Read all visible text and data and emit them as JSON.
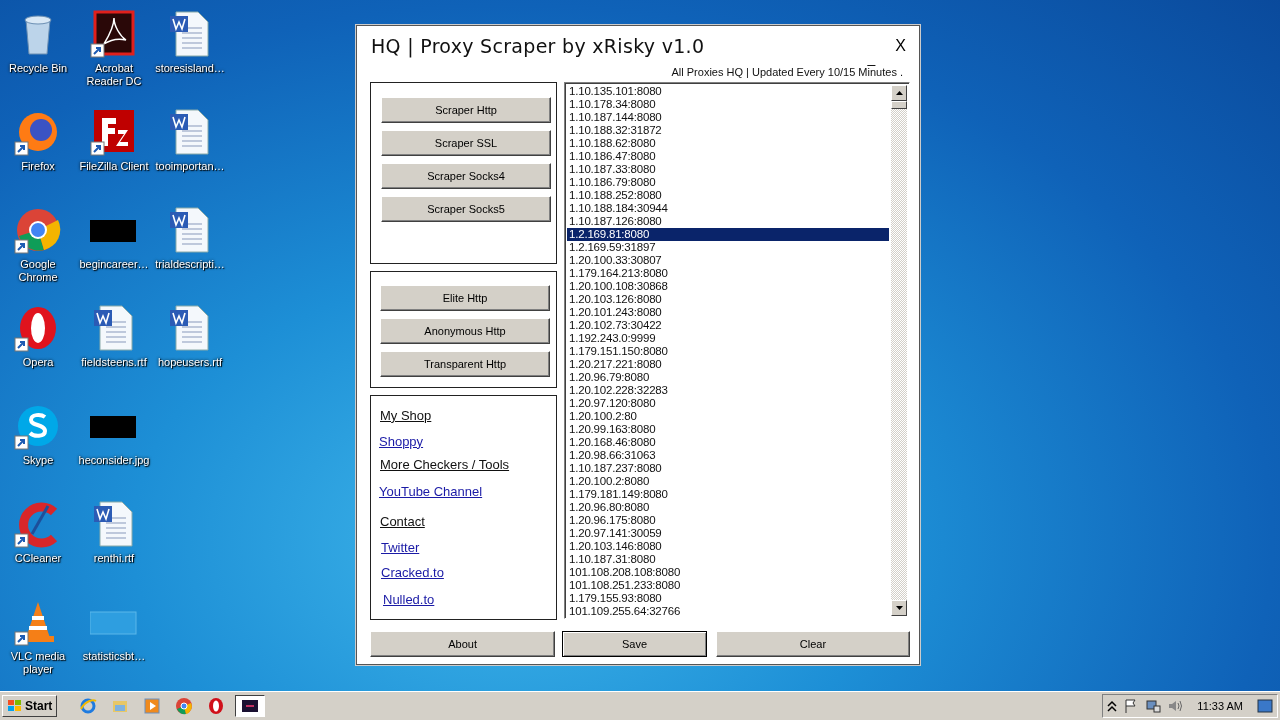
{
  "desktop": {
    "icons": [
      {
        "label": "Recycle Bin",
        "kind": "recycle",
        "shortcut": false
      },
      {
        "label": "Firefox",
        "kind": "firefox",
        "shortcut": true
      },
      {
        "label": "Google Chrome",
        "kind": "chrome",
        "shortcut": true
      },
      {
        "label": "Opera",
        "kind": "opera",
        "shortcut": true
      },
      {
        "label": "Skype",
        "kind": "skype",
        "shortcut": true
      },
      {
        "label": "CCleaner",
        "kind": "ccleaner",
        "shortcut": true
      },
      {
        "label": "VLC media player",
        "kind": "vlc",
        "shortcut": true
      },
      {
        "label": "Acrobat Reader DC",
        "kind": "pdf",
        "shortcut": true
      },
      {
        "label": "FileZilla Client",
        "kind": "filezilla",
        "shortcut": true
      },
      {
        "label": "begincareer…",
        "kind": "dark-image",
        "shortcut": false
      },
      {
        "label": "fieldsteens.rtf",
        "kind": "word",
        "shortcut": false
      },
      {
        "label": "heconsider.jpg",
        "kind": "dark-image",
        "shortcut": false
      },
      {
        "label": "renthi.rtf",
        "kind": "word",
        "shortcut": false
      },
      {
        "label": "statisticsbt…",
        "kind": "blank",
        "shortcut": false
      },
      {
        "label": "storesisland…",
        "kind": "word",
        "shortcut": false
      },
      {
        "label": "tooimportan…",
        "kind": "word",
        "shortcut": false
      },
      {
        "label": "trialdescripti…",
        "kind": "word",
        "shortcut": false
      },
      {
        "label": "hopeusers.rtf",
        "kind": "word",
        "shortcut": false
      }
    ]
  },
  "window": {
    "title": "HQ | Proxy Scraper by xRisky v1.0",
    "minimize": "_",
    "close": "X",
    "subtitle": "All Proxies HQ | Updated Every 10/15 Minutes ."
  },
  "scraper_buttons": [
    "Scraper Http",
    "Scraper SSL",
    "Scraper Socks4",
    "Scraper Socks5"
  ],
  "type_buttons": [
    "Elite Http",
    "Anonymous Http",
    "Transparent Http"
  ],
  "links": [
    {
      "text": "My Shop",
      "kind": "heading"
    },
    {
      "text": "Shoppy",
      "kind": "link"
    },
    {
      "text": "More Checkers / Tools",
      "kind": "heading"
    },
    {
      "text": "YouTube Channel",
      "kind": "link"
    },
    {
      "text": "Contact",
      "kind": "heading"
    },
    {
      "text": "Twitter",
      "kind": "link"
    },
    {
      "text": "Cracked.to",
      "kind": "link"
    },
    {
      "text": "Nulled.to",
      "kind": "link"
    }
  ],
  "proxies": [
    {
      "text": "1.10.135.101:8080",
      "selected": false
    },
    {
      "text": "1.10.178.34:8080",
      "selected": false
    },
    {
      "text": "1.10.187.144:8080",
      "selected": false
    },
    {
      "text": "1.10.188.32:31872",
      "selected": false
    },
    {
      "text": "1.10.188.62:8080",
      "selected": false
    },
    {
      "text": "1.10.186.47:8080",
      "selected": false
    },
    {
      "text": "1.10.187.33:8080",
      "selected": false
    },
    {
      "text": "1.10.186.79:8080",
      "selected": false
    },
    {
      "text": "1.10.188.252:8080",
      "selected": false
    },
    {
      "text": "1.10.188.184:30944",
      "selected": false
    },
    {
      "text": "1.10.187.126:8080",
      "selected": false
    },
    {
      "text": "1.2.169.81:8080",
      "selected": true
    },
    {
      "text": "1.2.169.59:31897",
      "selected": false
    },
    {
      "text": "1.20.100.33:30807",
      "selected": false
    },
    {
      "text": "1.179.164.213:8080",
      "selected": false
    },
    {
      "text": "1.20.100.108:30868",
      "selected": false
    },
    {
      "text": "1.20.103.126:8080",
      "selected": false
    },
    {
      "text": "1.20.101.243:8080",
      "selected": false
    },
    {
      "text": "1.20.102.73:30422",
      "selected": false
    },
    {
      "text": "1.192.243.0:9999",
      "selected": false
    },
    {
      "text": "1.179.151.150:8080",
      "selected": false
    },
    {
      "text": "1.20.217.221:8080",
      "selected": false
    },
    {
      "text": "1.20.96.79:8080",
      "selected": false
    },
    {
      "text": "1.20.102.228:32283",
      "selected": false
    },
    {
      "text": "1.20.97.120:8080",
      "selected": false
    },
    {
      "text": "1.20.100.2:80",
      "selected": false
    },
    {
      "text": "1.20.99.163:8080",
      "selected": false
    },
    {
      "text": "1.20.168.46:8080",
      "selected": false
    },
    {
      "text": "1.20.98.66:31063",
      "selected": false
    },
    {
      "text": "1.10.187.237:8080",
      "selected": false
    },
    {
      "text": "1.20.100.2:8080",
      "selected": false
    },
    {
      "text": "1.179.181.149:8080",
      "selected": false
    },
    {
      "text": "1.20.96.80:8080",
      "selected": false
    },
    {
      "text": "1.20.96.175:8080",
      "selected": false
    },
    {
      "text": "1.20.97.141:30059",
      "selected": false
    },
    {
      "text": "1.20.103.146:8080",
      "selected": false
    },
    {
      "text": "1.10.187.31:8080",
      "selected": false
    },
    {
      "text": "101.108.208.108:8080",
      "selected": false
    },
    {
      "text": "101.108.251.233:8080",
      "selected": false
    },
    {
      "text": "1.179.155.93:8080",
      "selected": false
    },
    {
      "text": "101.109.255.64:32766",
      "selected": false
    }
  ],
  "bottom_buttons": [
    {
      "label": "About",
      "pressed": false
    },
    {
      "label": "Save",
      "pressed": true
    },
    {
      "label": "Clear",
      "pressed": false
    }
  ],
  "taskbar": {
    "start": "Start",
    "apps": [
      {
        "kind": "ie",
        "active": false
      },
      {
        "kind": "folder",
        "active": false
      },
      {
        "kind": "media",
        "active": false
      },
      {
        "kind": "chrome",
        "active": false
      },
      {
        "kind": "opera",
        "active": false
      },
      {
        "kind": "app",
        "active": true
      }
    ],
    "clock": "11:33 AM"
  }
}
